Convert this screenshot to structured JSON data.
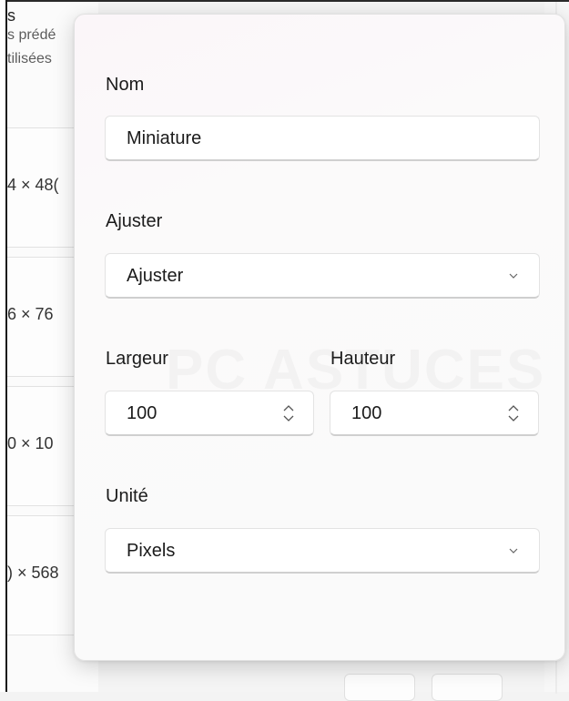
{
  "background": {
    "header_lines": [
      "s",
      "s prédé",
      "tilisées"
    ],
    "rows": [
      "4 × 48(",
      "6 × 76",
      "0 × 10",
      ") × 568"
    ]
  },
  "dialog": {
    "name_label": "Nom",
    "name_value": "Miniature",
    "fit_label": "Ajuster",
    "fit_value": "Ajuster",
    "width_label": "Largeur",
    "width_value": "100",
    "height_label": "Hauteur",
    "height_value": "100",
    "unit_label": "Unité",
    "unit_value": "Pixels"
  },
  "watermark_text": "PC ASTUCES",
  "icons": {
    "dropdown": "chevron-down-icon",
    "spinner": "up-down-spinner-icon"
  }
}
